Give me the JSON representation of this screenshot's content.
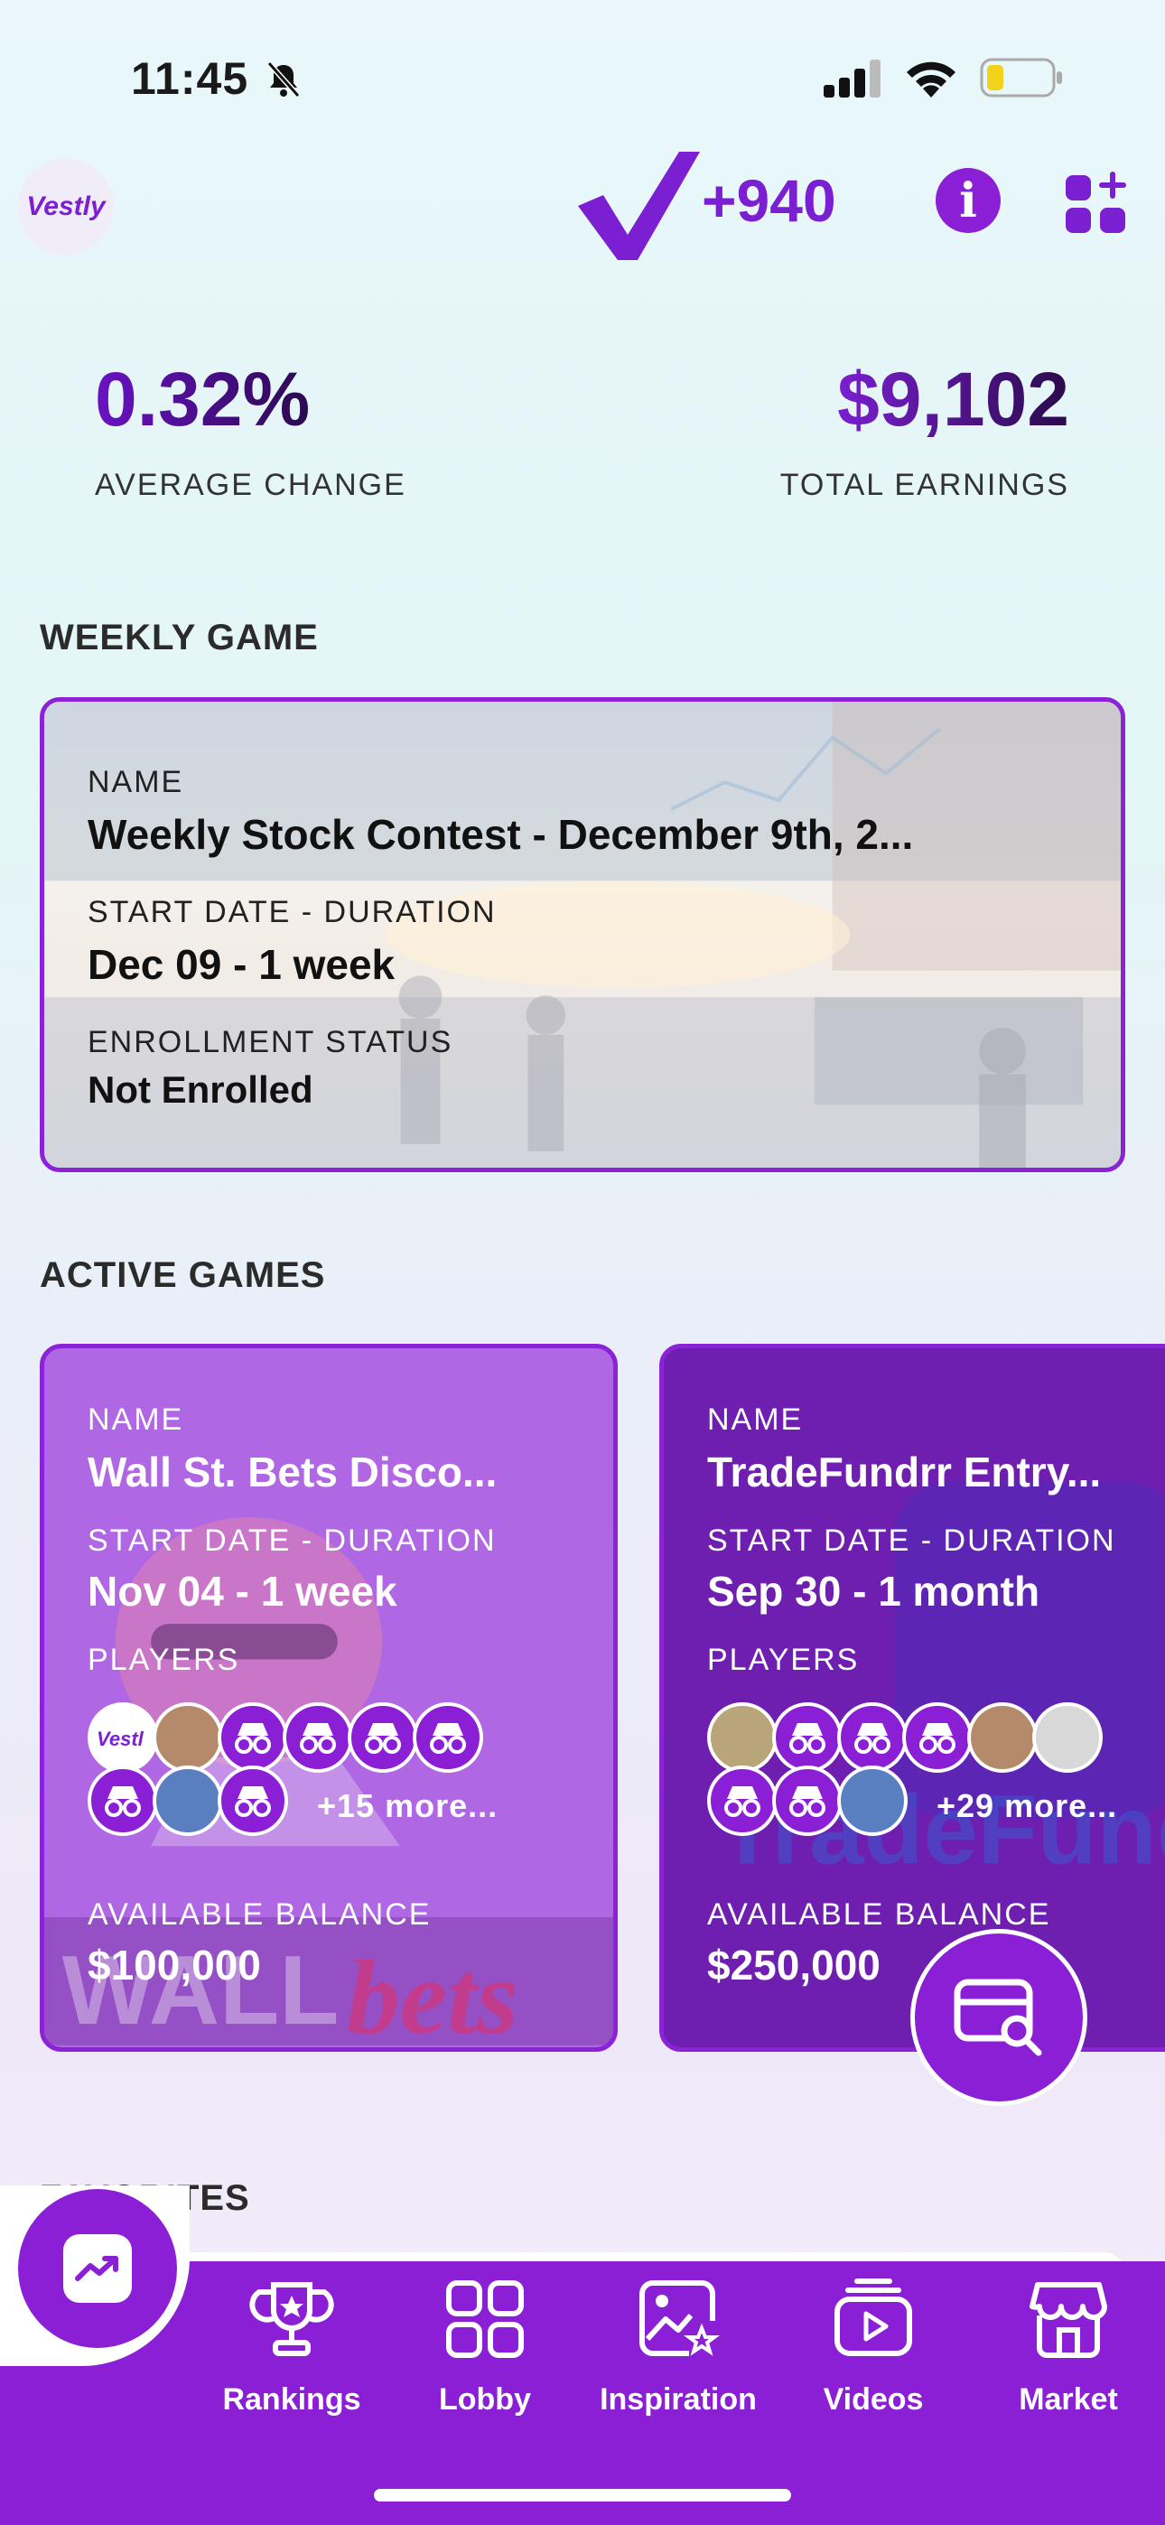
{
  "status_bar": {
    "time": "11:45"
  },
  "header": {
    "logo_text": "Vestly",
    "points": "+940"
  },
  "stats": {
    "average_change": {
      "value": "0.32%",
      "label": "AVERAGE CHANGE"
    },
    "total_earnings": {
      "value": "$9,102",
      "label": "TOTAL EARNINGS"
    }
  },
  "weekly_game": {
    "section_title": "WEEKLY GAME",
    "name_label": "NAME",
    "name": "Weekly Stock Contest - December 9th, 2...",
    "date_label": "START DATE - DURATION",
    "date": "Dec 09 - 1 week",
    "status_label": "ENROLLMENT STATUS",
    "status": "Not Enrolled"
  },
  "active_games": {
    "section_title": "ACTIVE GAMES",
    "cards": [
      {
        "name_label": "NAME",
        "name": "Wall St. Bets Disco...",
        "date_label": "START DATE - DURATION",
        "date": "Nov 04 - 1 week",
        "players_label": "PLAYERS",
        "more_players": "+15 more...",
        "balance_label": "AVAILABLE BALANCE",
        "balance": "$100,000"
      },
      {
        "name_label": "NAME",
        "name": "TradeFundrr Entry...",
        "date_label": "START DATE - DURATION",
        "date": "Sep 30 - 1 month",
        "players_label": "PLAYERS",
        "more_players": "+29 more...",
        "balance_label": "AVAILABLE BALANCE",
        "balance": "$250,000"
      }
    ]
  },
  "favorites": {
    "section_title": "FAVORITES"
  },
  "nav": [
    {
      "label": "Rankings",
      "icon": "trophy-icon"
    },
    {
      "label": "Lobby",
      "icon": "grid-icon"
    },
    {
      "label": "Inspiration",
      "icon": "image-star-icon"
    },
    {
      "label": "Videos",
      "icon": "video-play-icon"
    },
    {
      "label": "Market",
      "icon": "storefront-icon"
    }
  ],
  "colors": {
    "brand": "#8a1fd6",
    "brand_dark": "#6f1fb0",
    "card_light": "#b067e3"
  }
}
